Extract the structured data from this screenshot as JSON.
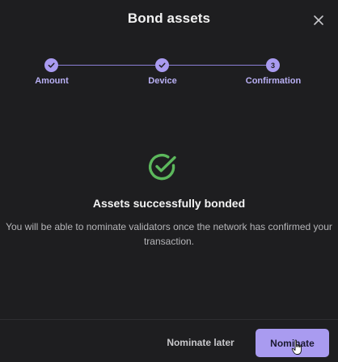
{
  "dialog": {
    "title": "Bond assets",
    "close_icon": "close-icon"
  },
  "stepper": {
    "steps": [
      {
        "label": "Amount",
        "state": "completed",
        "icon": "check-icon"
      },
      {
        "label": "Device",
        "state": "completed",
        "icon": "check-icon"
      },
      {
        "label": "Confirmation",
        "state": "active",
        "number": "3"
      }
    ]
  },
  "status": {
    "icon": "check-circle-icon",
    "title": "Assets successfully bonded",
    "message": "You will be able to nominate validators once the network has confirmed your transaction."
  },
  "footer": {
    "secondary_label": "Nominate later",
    "primary_label": "Nominate"
  },
  "colors": {
    "accent": "#a99bf0",
    "success": "#5cb85c",
    "background": "#1e1e20"
  }
}
